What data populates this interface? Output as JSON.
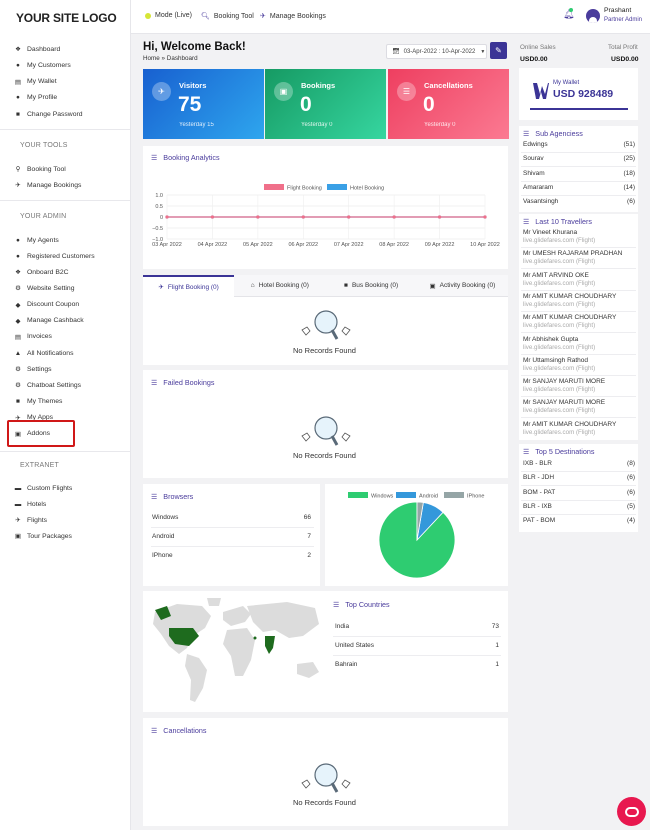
{
  "logo": "YOUR SITE LOGO",
  "sidebar": {
    "main_items": [
      {
        "label": "Dashboard",
        "icon": "dashboard-icon"
      },
      {
        "label": "My Customers",
        "icon": "user-icon"
      },
      {
        "label": "My Wallet",
        "icon": "wallet-icon"
      },
      {
        "label": "My Profile",
        "icon": "profile-icon"
      },
      {
        "label": "Change Password",
        "icon": "lock-icon"
      }
    ],
    "tools_heading": "YOUR TOOLS",
    "tools_items": [
      {
        "label": "Booking Tool",
        "icon": "search-icon"
      },
      {
        "label": "Manage Bookings",
        "icon": "plane-icon"
      }
    ],
    "admin_heading": "YOUR ADMIN",
    "admin_items": [
      {
        "label": "My Agents",
        "icon": "users-icon"
      },
      {
        "label": "Registered Customers",
        "icon": "user-icon"
      },
      {
        "label": "Onboard B2C",
        "icon": "onboard-icon"
      },
      {
        "label": "Website Setting",
        "icon": "gear-icon"
      },
      {
        "label": "Discount Coupon",
        "icon": "tag-icon"
      },
      {
        "label": "Manage Cashback",
        "icon": "tag-icon"
      },
      {
        "label": "Invoices",
        "icon": "invoice-icon"
      },
      {
        "label": "All Notifications",
        "icon": "bell-icon"
      },
      {
        "label": "Settings",
        "icon": "gear-icon"
      },
      {
        "label": "Chatboat Settings",
        "icon": "gear-icon"
      },
      {
        "label": "My Themes",
        "icon": "theme-icon"
      },
      {
        "label": "My Apps",
        "icon": "apps-icon"
      },
      {
        "label": "Addons",
        "icon": "addons-icon"
      }
    ],
    "extranet_heading": "EXTRANET",
    "extranet_items": [
      {
        "label": "Custom Flights",
        "icon": "bed-icon"
      },
      {
        "label": "Hotels",
        "icon": "bed-icon"
      },
      {
        "label": "Flights",
        "icon": "plane-icon"
      },
      {
        "label": "Tour Packages",
        "icon": "camera-icon"
      }
    ]
  },
  "topbar": {
    "mode": "Mode (Live)",
    "booking_tool": "Booking Tool",
    "manage_bookings": "Manage Bookings",
    "user_name": "Prashant",
    "user_role": "Partner Admin"
  },
  "welcome": {
    "title": "Hi, Welcome Back!",
    "breadcrumb": "Home » Dashboard",
    "date_range": "03-Apr-2022 : 10-Apr-2022"
  },
  "stats": [
    {
      "label": "Visitors",
      "value": "75",
      "sub": "Yesterday 15",
      "color": "#1e6fd9"
    },
    {
      "label": "Bookings",
      "value": "0",
      "sub": "Yesterday 0",
      "color": "#22b07d"
    },
    {
      "label": "Cancellations",
      "value": "0",
      "sub": "Yesterday 0",
      "color": "#f0506e"
    }
  ],
  "booking_analytics": {
    "title": "Booking Analytics",
    "chart_data": {
      "type": "line",
      "x": [
        "03 Apr 2022",
        "04 Apr 2022",
        "05 Apr 2022",
        "06 Apr 2022",
        "07 Apr 2022",
        "08 Apr 2022",
        "09 Apr 2022",
        "10 Apr 2022"
      ],
      "series": [
        {
          "name": "Flight Booking",
          "values": [
            0,
            0,
            0,
            0,
            0,
            0,
            0,
            0
          ],
          "color": "#f0708a"
        },
        {
          "name": "Hotel Booking",
          "values": [
            0,
            0,
            0,
            0,
            0,
            0,
            0,
            0
          ],
          "color": "#3aa0e6"
        }
      ],
      "y_ticks": [
        "1.0",
        "0.5",
        "0",
        "−0.5",
        "−1.0"
      ],
      "ylim": [
        -1,
        1
      ],
      "legend": "top-center",
      "grid": true
    }
  },
  "booking_tabs": [
    {
      "label": "Flight Booking (0)",
      "icon": "plane-icon"
    },
    {
      "label": "Hotel Booking (0)",
      "icon": "hotel-icon"
    },
    {
      "label": "Bus Booking (0)",
      "icon": "bus-icon"
    },
    {
      "label": "Activity Booking (0)",
      "icon": "camera-icon"
    }
  ],
  "no_records": "No Records Found",
  "failed_bookings": {
    "title": "Failed Bookings"
  },
  "browsers": {
    "title": "Browsers",
    "rows": [
      {
        "name": "Windows",
        "value": "66"
      },
      {
        "name": "Android",
        "value": "7"
      },
      {
        "name": "IPhone",
        "value": "2"
      }
    ],
    "chart_data": {
      "type": "pie",
      "categories": [
        "Windows",
        "Android",
        "IPhone"
      ],
      "values": [
        66,
        7,
        2
      ],
      "colors": [
        "#2ecc71",
        "#3498db",
        "#95a5a6"
      ],
      "legend": "top"
    }
  },
  "top_countries": {
    "title": "Top Countries",
    "rows": [
      {
        "name": "India",
        "value": "73"
      },
      {
        "name": "United States",
        "value": "1"
      },
      {
        "name": "Bahrain",
        "value": "1"
      }
    ]
  },
  "cancellations": {
    "title": "Cancellations"
  },
  "right": {
    "online_sales_label": "Online Sales",
    "online_sales_value": "USD0.00",
    "total_profit_label": "Total Profit",
    "total_profit_value": "USD0.00",
    "wallet_label": "My Wallet",
    "wallet_value": "USD 928489",
    "sub_agencies_title": "Sub Agenciess",
    "sub_agencies": [
      {
        "name": "Edwings",
        "count": "(51)"
      },
      {
        "name": "Sourav",
        "count": "(25)"
      },
      {
        "name": "Shivam",
        "count": "(18)"
      },
      {
        "name": "Amararam",
        "count": "(14)"
      },
      {
        "name": "Vasantsingh",
        "count": "(6)"
      }
    ],
    "travellers_title": "Last 10 Travellers",
    "travellers": [
      {
        "name": "Mr Vineet Khurana",
        "sub": "live.glidefares.com (Flight)"
      },
      {
        "name": "Mr UMESH RAJARAM PRADHAN",
        "sub": "live.glidefares.com (Flight)"
      },
      {
        "name": "Mr AMIT ARVIND OKE",
        "sub": "live.glidefares.com (Flight)"
      },
      {
        "name": "Mr AMIT KUMAR CHOUDHARY",
        "sub": "live.glidefares.com (Flight)"
      },
      {
        "name": "Mr AMIT KUMAR CHOUDHARY",
        "sub": "live.glidefares.com (Flight)"
      },
      {
        "name": "Mr Abhishek Gupta",
        "sub": "live.glidefares.com (Flight)"
      },
      {
        "name": "Mr Uttamsingh Rathod",
        "sub": "live.glidefares.com (Flight)"
      },
      {
        "name": "Mr SANJAY MARUTI MORE",
        "sub": "live.glidefares.com (Flight)"
      },
      {
        "name": "Mr SANJAY MARUTI MORE",
        "sub": "live.glidefares.com (Flight)"
      },
      {
        "name": "Mr AMIT KUMAR CHOUDHARY",
        "sub": "live.glidefares.com (Flight)"
      }
    ],
    "destinations_title": "Top 5 Destinations",
    "destinations": [
      {
        "route": "IXB - BLR",
        "count": "(8)"
      },
      {
        "route": "BLR - JDH",
        "count": "(6)"
      },
      {
        "route": "BOM - PAT",
        "count": "(6)"
      },
      {
        "route": "BLR - IXB",
        "count": "(5)"
      },
      {
        "route": "PAT - BOM",
        "count": "(4)"
      }
    ]
  },
  "accent_color": "#4a3c9c"
}
